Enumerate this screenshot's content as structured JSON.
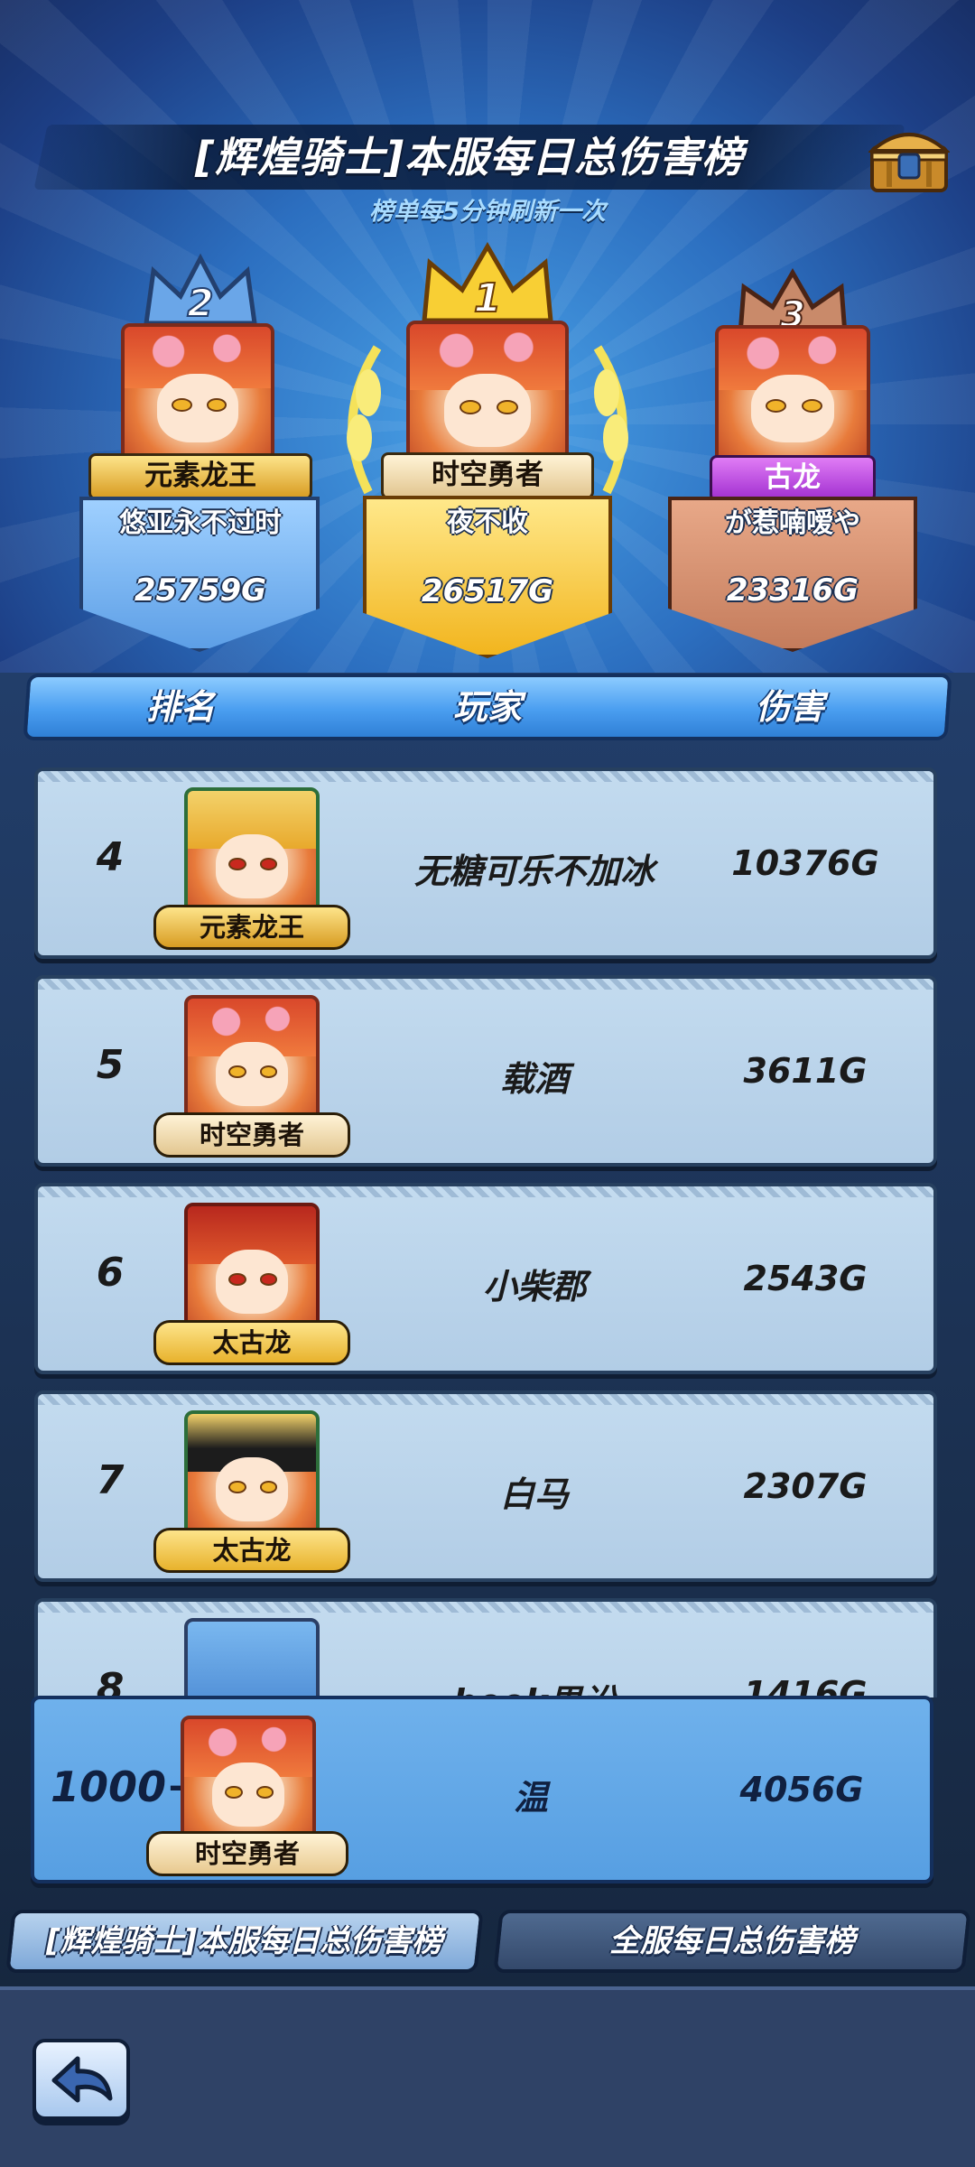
{
  "header": {
    "title": "[辉煌骑士]本服每日总伤害榜",
    "subtitle": "榜单每5分钟刷新一次"
  },
  "podium": [
    {
      "rank": "2",
      "title": "元素龙王",
      "player": "悠亚永不过时",
      "damage": "25759G",
      "color": "#7fb8ef"
    },
    {
      "rank": "1",
      "title": "时空勇者",
      "player": "夜不收",
      "damage": "26517G",
      "color": "#f6cc3a"
    },
    {
      "rank": "3",
      "title": "古龙",
      "player": "が惹喃嗳や",
      "damage": "23316G",
      "color": "#d0906f"
    }
  ],
  "columns": {
    "rank": "排名",
    "player": "玩家",
    "damage": "伤害"
  },
  "rows": [
    {
      "rank": "4",
      "title": "元素龙王",
      "player": "无糖可乐不加冰",
      "damage": "10376G"
    },
    {
      "rank": "5",
      "title": "时空勇者",
      "player": "载酒",
      "damage": "3611G"
    },
    {
      "rank": "6",
      "title": "太古龙",
      "player": "小柴郡",
      "damage": "2543G"
    },
    {
      "rank": "7",
      "title": "太古龙",
      "player": "白马",
      "damage": "2307G"
    },
    {
      "rank": "8",
      "title": "",
      "player": "book男讼",
      "damage": "1416G"
    }
  ],
  "self": {
    "rank": "1000+",
    "title": "时空勇者",
    "player": "温",
    "damage": "4056G"
  },
  "tabs": [
    {
      "label": "[辉煌骑士]本服每日总伤害榜",
      "active": true
    },
    {
      "label": "全服每日总伤害榜",
      "active": false
    }
  ],
  "icons": {
    "back": "back-arrow-icon",
    "chest": "treasure-chest-icon"
  },
  "colors": {
    "accent": "#4a9ef0",
    "row_bg": "#b8d3ea",
    "self_bg": "#62a8e8"
  }
}
